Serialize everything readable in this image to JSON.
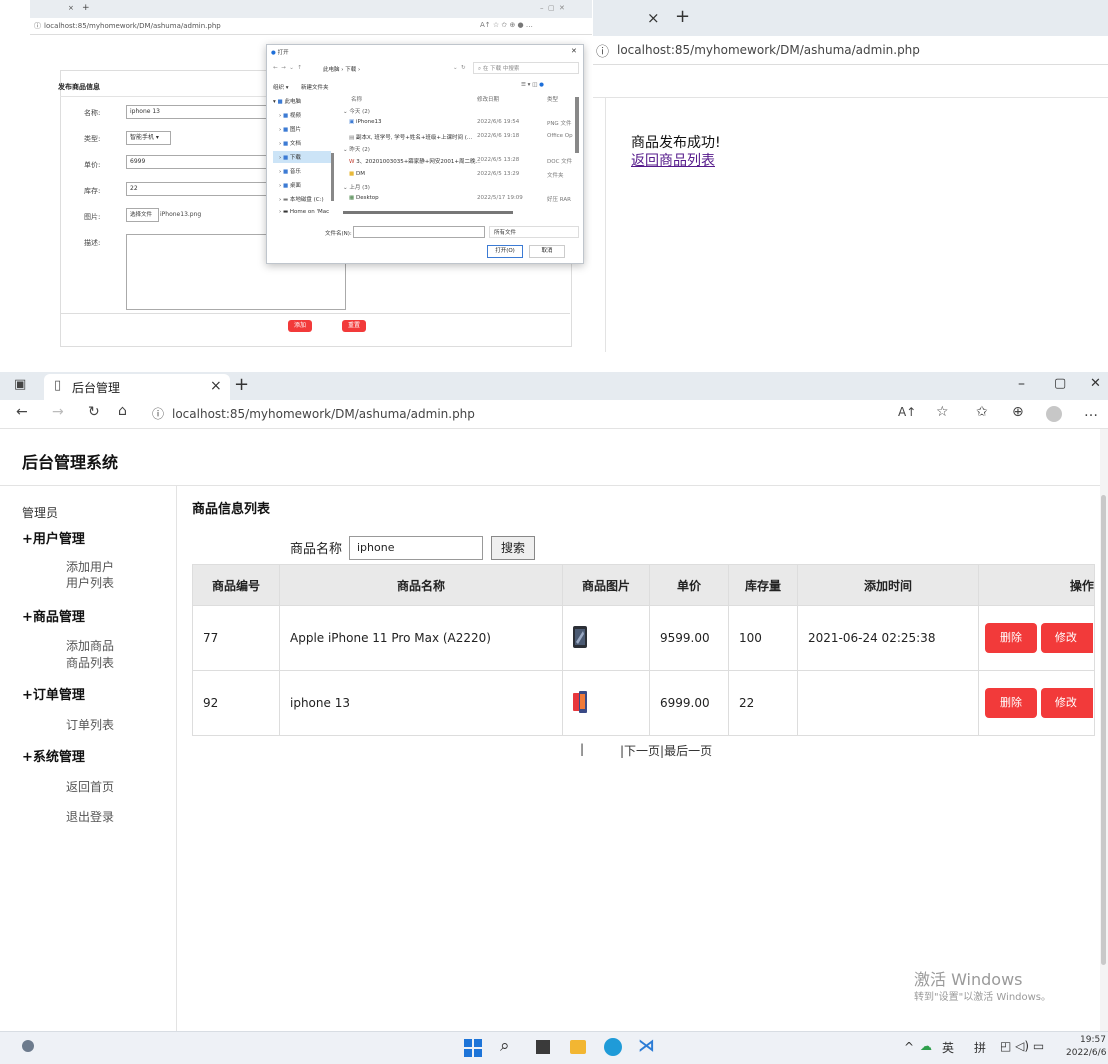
{
  "top_left": {
    "tab_close": "×",
    "tab_new": "+",
    "url": "localhost:85/myhomework/DM/ashuma/admin.php",
    "form_title": "发布商品信息",
    "fields": [
      {
        "label": "名称:",
        "value": "iphone 13"
      },
      {
        "label": "类型:",
        "value": "智能手机"
      },
      {
        "label": "单价:",
        "value": "6999"
      },
      {
        "label": "库存:",
        "value": "22"
      },
      {
        "label": "图片:",
        "value": "iPhone13.png"
      },
      {
        "label": "描述:",
        "value": ""
      }
    ],
    "choose_file": "选择文件",
    "add_button": "添加",
    "reset_button": "重置",
    "dialog": {
      "title": "打开",
      "breadcrumb": "此电脑 › 下载 ›",
      "search_placeholder": "在 下载 中搜索",
      "organize": "组织 ▾",
      "new_folder": "新建文件夹",
      "col_name": "名称",
      "col_date": "修改日期",
      "col_type": "类型",
      "sidebar": [
        "此电脑",
        "视频",
        "图片",
        "文档",
        "下载",
        "音乐",
        "桌面",
        "本地磁盘 (C:)",
        "Home on 'Mac"
      ],
      "groups": [
        {
          "label": "今天 (2)",
          "rows": [
            {
              "name": "iPhone13",
              "date": "2022/6/6 19:54",
              "type": "PNG 文件"
            },
            {
              "name": "副本X, 班学号, 学号+姓名+班级+上课时间 (...",
              "date": "2022/6/6 19:18",
              "type": "Office Op"
            }
          ]
        },
        {
          "label": "昨天 (2)",
          "rows": [
            {
              "name": "3、20201003035+薛家静+网安2001+周二晚...",
              "date": "2022/6/5 13:28",
              "type": "DOC 文件"
            },
            {
              "name": "DM",
              "date": "2022/6/5 13:29",
              "type": "文件夹"
            }
          ]
        },
        {
          "label": "上月 (3)",
          "rows": [
            {
              "name": "Desktop",
              "date": "2022/5/17 19:09",
              "type": "好压 RAR"
            }
          ]
        }
      ],
      "filename_label": "文件名(N):",
      "filter": "所有文件",
      "open_button": "打开(O)",
      "cancel_button": "取消"
    }
  },
  "top_right": {
    "tab_close": "×",
    "tab_new": "+",
    "url": "localhost:85/myhomework/DM/ashuma/admin.php",
    "success_message": "商品发布成功!",
    "back_link": "返回商品列表"
  },
  "browser": {
    "tab_title": "后台管理",
    "tab_close": "×",
    "tab_new": "+",
    "url": "localhost:85/myhomework/DM/ashuma/admin.php",
    "win_min": "–",
    "win_max": "▢",
    "win_close": "✕"
  },
  "page": {
    "site_title": "后台管理系统",
    "role": "管理员",
    "sidebar": [
      {
        "heading": "+用户管理",
        "items": [
          "添加用户",
          "用户列表"
        ]
      },
      {
        "heading": "+商品管理",
        "items": [
          "添加商品",
          "商品列表"
        ]
      },
      {
        "heading": "+订单管理",
        "items": [
          "订单列表"
        ]
      },
      {
        "heading": "+系统管理",
        "items": [
          "返回首页",
          "退出登录"
        ]
      }
    ],
    "list_title": "商品信息列表",
    "search_label": "商品名称",
    "search_value": "iphone",
    "search_button": "搜索",
    "columns": [
      "商品编号",
      "商品名称",
      "商品图片",
      "单价",
      "库存量",
      "添加时间",
      "操作"
    ],
    "rows": [
      {
        "id": "77",
        "name": "Apple iPhone 11 Pro Max (A2220)",
        "price": "9599.00",
        "stock": "100",
        "time": "2021-06-24 02:25:38",
        "delete": "删除",
        "edit": "修改"
      },
      {
        "id": "92",
        "name": "iphone 13",
        "price": "6999.00",
        "stock": "22",
        "time": "",
        "delete": "删除",
        "edit": "修改"
      }
    ],
    "pager_sep": "|",
    "pager": "|下一页|最后一页",
    "watermark_title": "激活 Windows",
    "watermark_sub": "转到\"设置\"以激活 Windows。"
  },
  "taskbar": {
    "ime_lang": "英",
    "ime_mode": "拼",
    "time": "19:57",
    "date": "2022/6/6"
  },
  "colors": {
    "accent_red": "#f23a3a",
    "link_purple": "#551a8b",
    "table_header": "#e9e9e9"
  }
}
